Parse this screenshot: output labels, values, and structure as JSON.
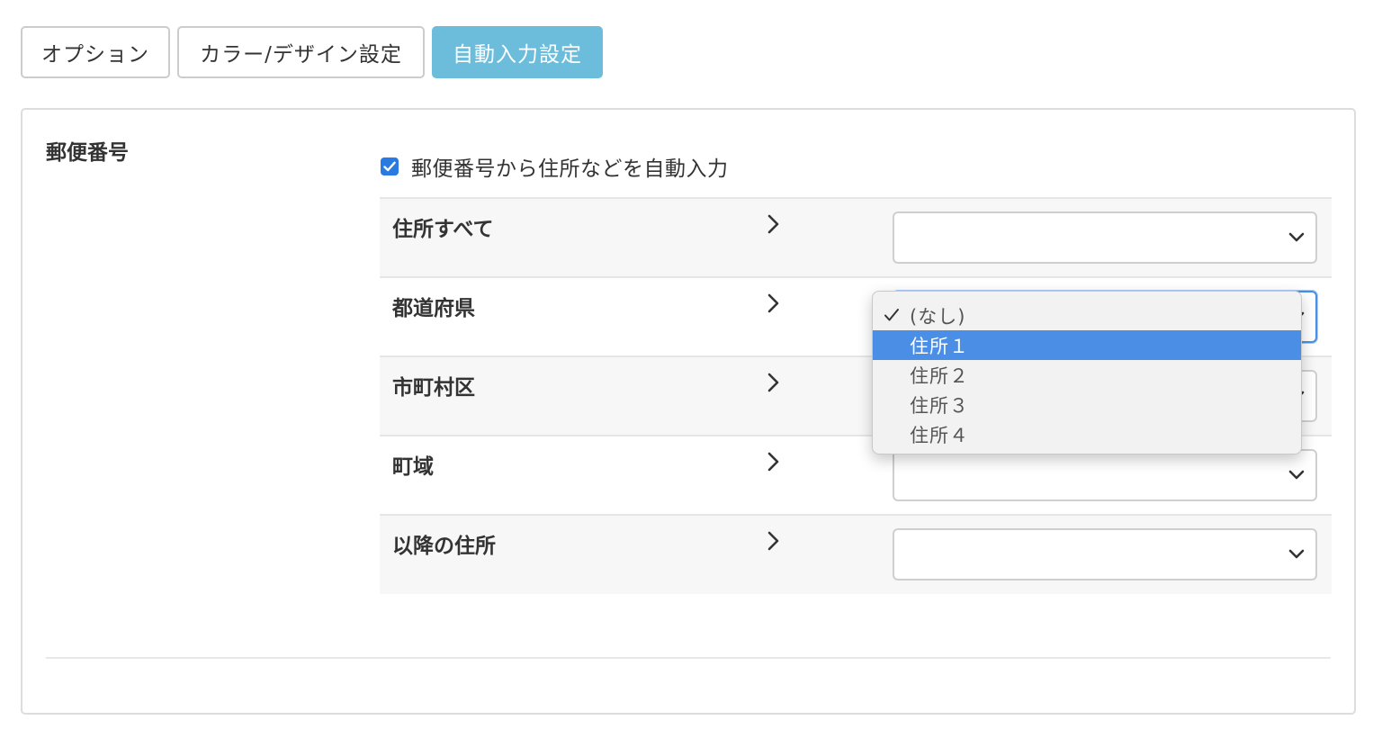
{
  "tabs": [
    {
      "label": "オプション"
    },
    {
      "label": "カラー/デザイン設定"
    },
    {
      "label": "自動入力設定",
      "active": true
    }
  ],
  "section": {
    "title": "郵便番号",
    "checkbox": {
      "label": "郵便番号から住所などを自動入力",
      "checked": true
    }
  },
  "fields": [
    {
      "label": "住所すべて",
      "value": ""
    },
    {
      "label": "都道府県",
      "value": "(なし)"
    },
    {
      "label": "市町村区",
      "value": ""
    },
    {
      "label": "町域",
      "value": ""
    },
    {
      "label": "以降の住所",
      "value": ""
    }
  ],
  "dropdown": {
    "options": [
      "(なし)",
      "住所１",
      "住所２",
      "住所３",
      "住所４"
    ],
    "selected": "(なし)",
    "highlighted": "住所１"
  },
  "colors": {
    "accent": "#6cbddc",
    "checkbox": "#2a7ae4",
    "highlight": "#4a8ee6",
    "focus": "#4a90e2"
  },
  "icons": {
    "row_arrow": "chevron-right-icon",
    "select_arrow": "chevron-down-icon",
    "selected_mark": "checkmark-icon"
  }
}
